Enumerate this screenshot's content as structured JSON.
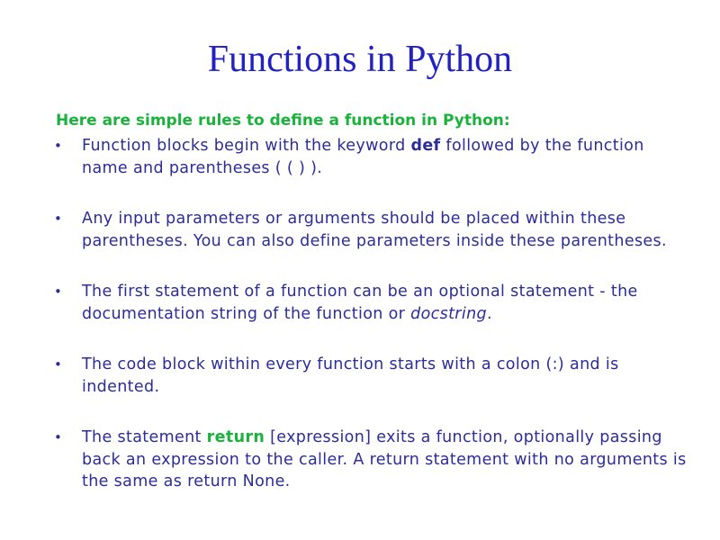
{
  "slide": {
    "title": "Functions in Python",
    "intro": "Here are simple rules to define a function in Python:",
    "bullets": [
      {
        "part1": "Function blocks begin with the keyword ",
        "keyword": "def",
        "part2": " followed by the function name and parentheses ( ( ) )."
      },
      {
        "text": "Any input parameters or arguments should be placed within these parentheses. You can also define parameters inside these parentheses."
      },
      {
        "part1": "The first statement of a function can be an optional statement - the documentation string of the function or ",
        "italic": "docstring",
        "part2": "."
      },
      {
        "text": "The code block within every function starts with a colon (:) and is indented."
      },
      {
        "part1": "The statement ",
        "keyword": "return",
        "part2": " [expression] exits a function, optionally passing back an expression to the caller. A return statement with no arguments is the same as return None."
      }
    ],
    "bullet_symbol": "•",
    "colors": {
      "title": "#2222c2",
      "body": "#2c2c9a",
      "highlight": "#19b33c",
      "background": "#ffffff"
    }
  }
}
